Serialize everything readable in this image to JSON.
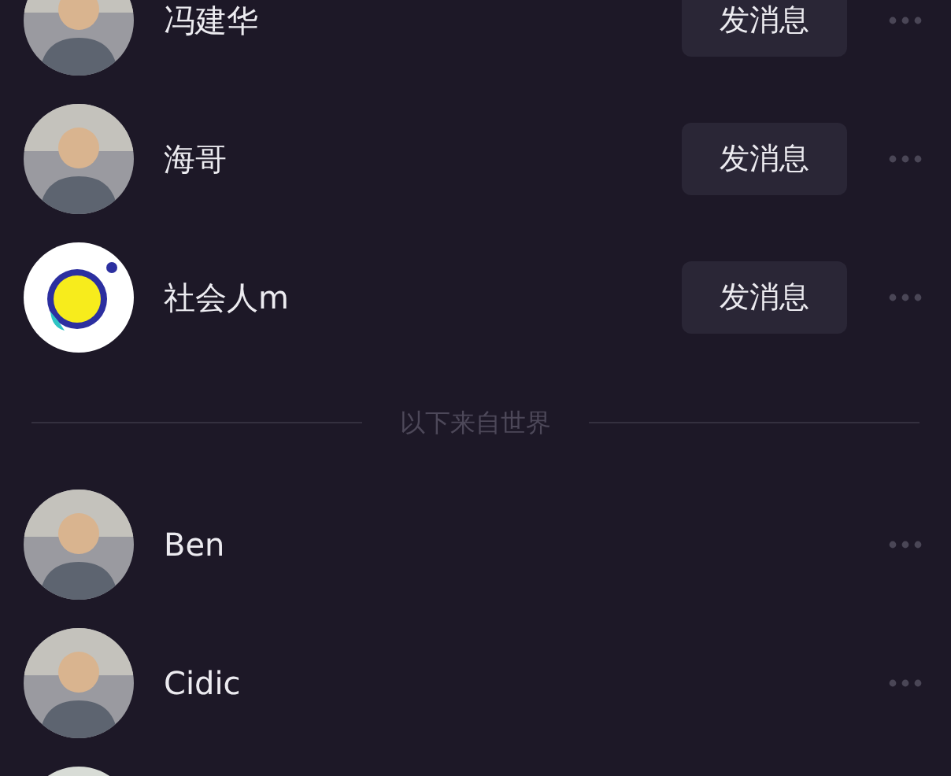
{
  "friends": [
    {
      "name": "冯建华",
      "button": "发消息"
    },
    {
      "name": "海哥",
      "button": "发消息"
    },
    {
      "name": "社会人m",
      "kind": "logo",
      "button": "发消息"
    }
  ],
  "divider": "以下来自世界",
  "others": [
    {
      "name": "Ben"
    },
    {
      "name": "Cidic"
    }
  ]
}
